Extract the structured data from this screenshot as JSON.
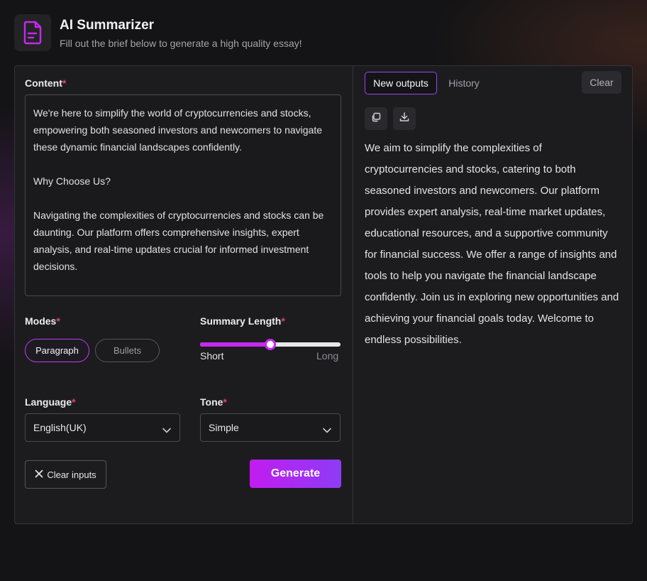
{
  "header": {
    "icon": "document-icon",
    "title": "AI Summarizer",
    "subtitle": "Fill out the brief below to generate a high quality essay!"
  },
  "form": {
    "content_label": "Content",
    "required_mark": "*",
    "content_paragraphs": [
      "We're here to simplify the world of cryptocurrencies and stocks, empowering both seasoned investors and newcomers to navigate these dynamic financial landscapes confidently.",
      "Why Choose Us?",
      "Navigating the complexities of cryptocurrencies and stocks can be daunting. Our platform offers comprehensive insights, expert analysis, and real-time updates crucial for informed investment decisions."
    ],
    "modes_label": "Modes",
    "modes": [
      "Paragraph",
      "Bullets"
    ],
    "selected_mode": "Paragraph",
    "summary_length_label": "Summary Length",
    "summary_length_min_label": "Short",
    "summary_length_max_label": "Long",
    "summary_length_value": 0.5,
    "language_label": "Language",
    "language_value": "English(UK)",
    "tone_label": "Tone",
    "tone_value": "Simple",
    "clear_label": "Clear inputs",
    "generate_label": "Generate"
  },
  "output": {
    "tabs": [
      "New outputs",
      "History"
    ],
    "active_tab": "New outputs",
    "clear_label": "Clear",
    "icons": [
      "copy-icon",
      "download-icon"
    ],
    "text": "We aim to simplify the complexities of cryptocurrencies and stocks, catering to both seasoned investors and newcomers. Our platform provides expert analysis, real-time market updates, educational resources, and a supportive community for financial success. We offer a range of insights and tools to help you navigate the financial landscape confidently. Join us in exploring new opportunities and achieving your financial goals today. Welcome to endless possibilities."
  },
  "colors": {
    "accent": "#c52af0",
    "accent_end": "#8d3cf5",
    "required": "#e0475e",
    "panel": "#1c1c1f",
    "background": "#141416"
  }
}
